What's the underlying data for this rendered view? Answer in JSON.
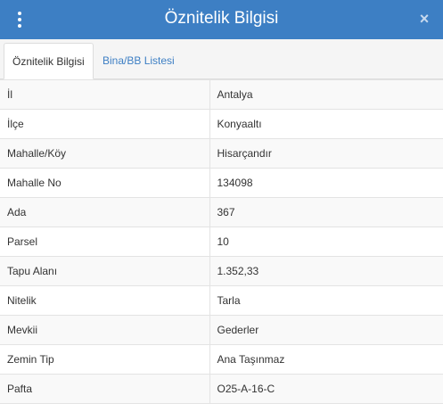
{
  "header": {
    "title": "Öznitelik Bilgisi",
    "close_glyph": "×",
    "menu_icon": "vertical-dots-icon",
    "close_icon": "close-icon"
  },
  "tabs": [
    {
      "label": "Öznitelik Bilgisi",
      "active": true
    },
    {
      "label": "Bina/BB Listesi",
      "active": false
    }
  ],
  "attributes": [
    {
      "key": "İl",
      "value": "Antalya"
    },
    {
      "key": "İlçe",
      "value": "Konyaaltı"
    },
    {
      "key": "Mahalle/Köy",
      "value": "Hisarçandır"
    },
    {
      "key": "Mahalle No",
      "value": "134098"
    },
    {
      "key": "Ada",
      "value": "367"
    },
    {
      "key": "Parsel",
      "value": "10"
    },
    {
      "key": "Tapu Alanı",
      "value": "1.352,33"
    },
    {
      "key": "Nitelik",
      "value": "Tarla"
    },
    {
      "key": "Mevkii",
      "value": "Gederler"
    },
    {
      "key": "Zemin Tip",
      "value": "Ana Taşınmaz"
    },
    {
      "key": "Pafta",
      "value": "O25-A-16-C"
    }
  ],
  "colors": {
    "header_bg": "#3d7fc4",
    "tab_link": "#3d7fc4",
    "row_odd": "#f9f9f9",
    "row_even": "#ffffff",
    "border": "#e3e3e3"
  }
}
